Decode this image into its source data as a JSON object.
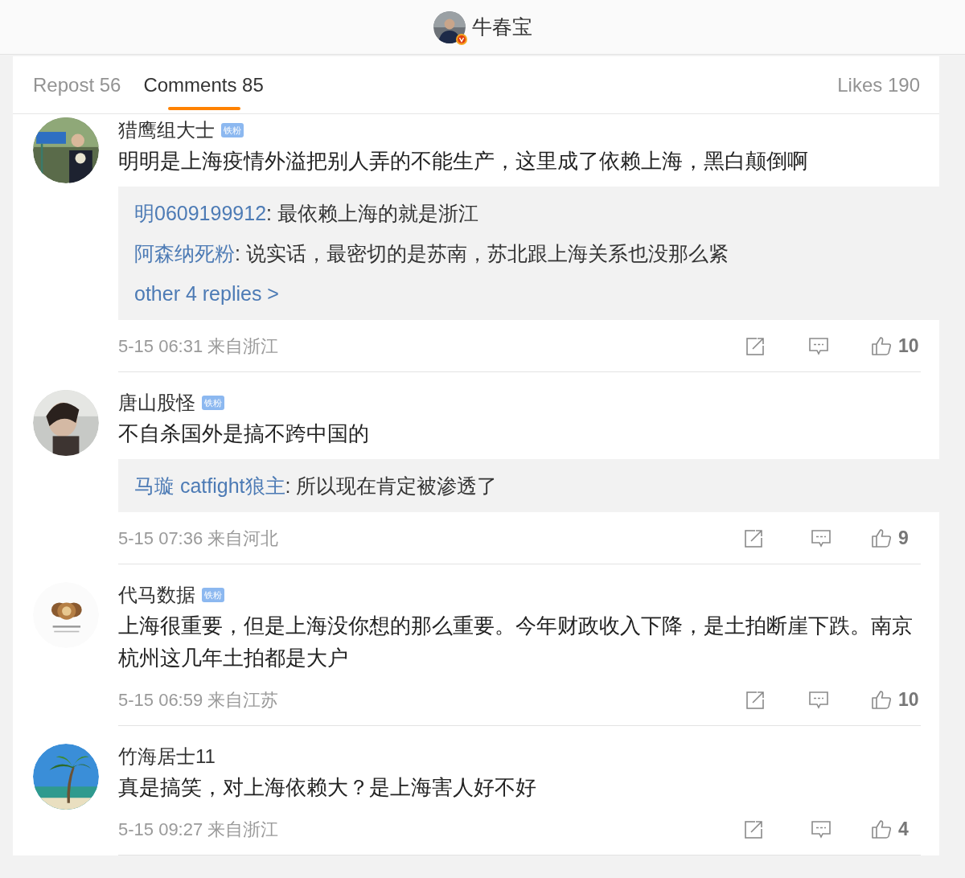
{
  "header": {
    "name": "牛春宝",
    "verified": true
  },
  "tabs": [
    {
      "label": "Repost 56",
      "selected": false
    },
    {
      "label": "Comments 85",
      "selected": true
    }
  ],
  "likes_tab": "Likes 190",
  "comments": [
    {
      "user": "猎鹰组大士",
      "badge": "铁粉",
      "text": "明明是上海疫情外溢把别人弄的不能生产，这里成了依赖上海，黑白颠倒啊",
      "replies": [
        {
          "user": "明0609199912",
          "text": ": 最依赖上海的就是浙江"
        },
        {
          "user": "阿森纳死粉",
          "text": ": 说实话，最密切的是苏南，苏北跟上海关系也没那么紧"
        }
      ],
      "more": "other 4 replies >",
      "meta": "5-15 06:31 来自浙江",
      "likes": "10"
    },
    {
      "user": "唐山股怪",
      "badge": "铁粉",
      "text": "不自杀国外是搞不跨中国的",
      "replies": [
        {
          "user": "马璇 catfight狼主",
          "text": ": 所以现在肯定被渗透了"
        }
      ],
      "meta": "5-15 07:36 来自河北",
      "likes": "9"
    },
    {
      "user": "代马数据",
      "badge": "铁粉",
      "text": "上海很重要，但是上海没你想的那么重要。今年财政收入下降，是土拍断崖下跌。南京杭州这几年土拍都是大户",
      "meta": "5-15 06:59 来自江苏",
      "likes": "10"
    },
    {
      "user": "竹海居士11",
      "text": "真是搞笑，对上海依赖大？是上海害人好不好",
      "meta": "5-15 09:27 来自浙江",
      "likes": "4"
    }
  ]
}
